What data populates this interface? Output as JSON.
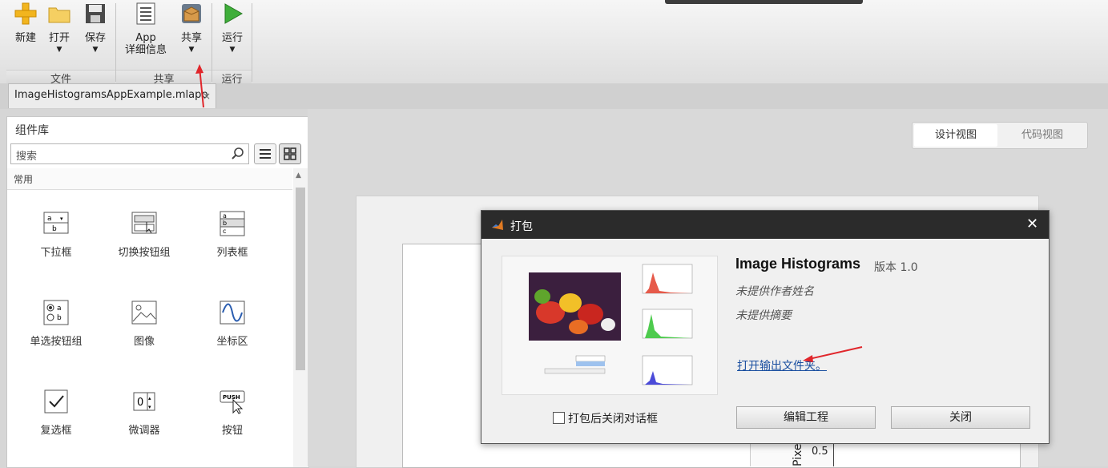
{
  "toolstrip": {
    "buttons": {
      "new": "新建",
      "open": "打开",
      "save": "保存",
      "app_details_line1": "App",
      "app_details_line2": "详细信息",
      "share": "共享",
      "run": "运行"
    },
    "sections": {
      "file": "文件",
      "share": "共享",
      "run": "运行"
    }
  },
  "file_tab": {
    "name": "ImageHistogramsAppExample.mlapp",
    "close": "×"
  },
  "component_library": {
    "title": "组件库",
    "search_placeholder": "搜索",
    "category": "常用",
    "items": [
      {
        "label": "下拉框",
        "icon": "dropdown-icon"
      },
      {
        "label": "切换按钮组",
        "icon": "toggle-button-group-icon"
      },
      {
        "label": "列表框",
        "icon": "listbox-icon"
      },
      {
        "label": "单选按钮组",
        "icon": "radio-button-group-icon"
      },
      {
        "label": "图像",
        "icon": "image-icon"
      },
      {
        "label": "坐标区",
        "icon": "axes-icon"
      },
      {
        "label": "复选框",
        "icon": "checkbox-icon"
      },
      {
        "label": "微调器",
        "icon": "spinner-icon"
      },
      {
        "label": "按钮",
        "icon": "push-button-icon"
      }
    ]
  },
  "view_toggle": {
    "design": "设计视图",
    "code": "代码视图"
  },
  "canvas": {
    "axis_label_fragment": "Pixe",
    "axis_tick": "0.5"
  },
  "dialog": {
    "title": "打包",
    "close": "✕",
    "app_name": "Image Histograms",
    "version": "版本 1.0",
    "author": "未提供作者姓名",
    "summary": "未提供摘要",
    "open_output_folder": "打开输出文件夹。",
    "close_after_package": "打包后关闭对话框",
    "edit_project": "编辑工程",
    "close_button": "关闭"
  },
  "colors": {
    "dialog_titlebar": "#2b2b2b",
    "link": "#1a4fa0",
    "annotation_arrow": "#e0262b"
  }
}
